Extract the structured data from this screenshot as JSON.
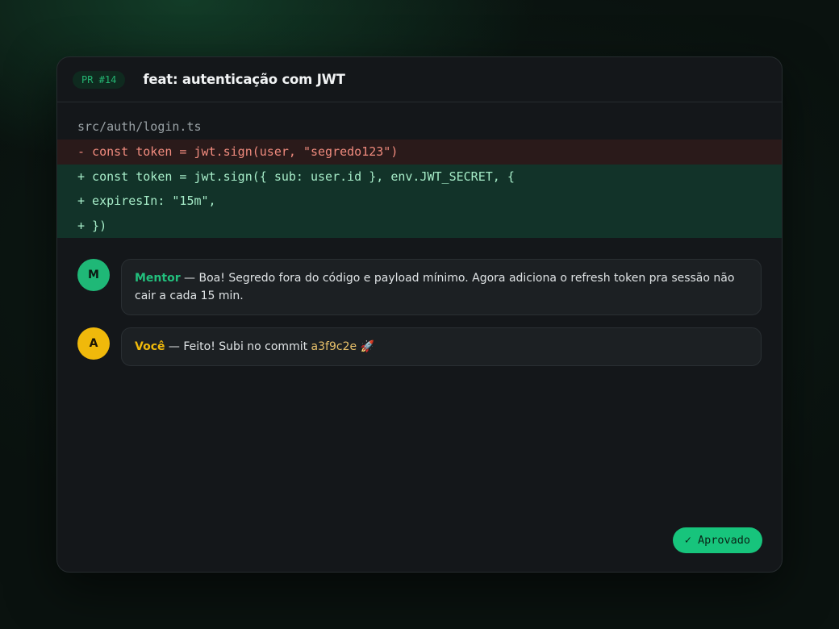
{
  "header": {
    "pr_badge": "PR #14",
    "title": "feat: autenticação com JWT"
  },
  "diff": {
    "file_path": "src/auth/login.ts",
    "lines": [
      {
        "type": "del",
        "text": "- const token = jwt.sign(user, \"segredo123\")"
      },
      {
        "type": "add",
        "text": "+ const token = jwt.sign({ sub: user.id }, env.JWT_SECRET, {"
      },
      {
        "type": "add",
        "text": "+ expiresIn: \"15m\","
      },
      {
        "type": "add",
        "text": "+ })"
      }
    ]
  },
  "comments": [
    {
      "avatar": "M",
      "author": "Mentor",
      "separator": " — ",
      "text": "Boa! Segredo fora do código e payload mínimo. Agora adiciona o refresh token pra sessão não cair a cada 15 min."
    },
    {
      "avatar": "A",
      "author": "Você",
      "separator": " — ",
      "text": "Feito! Subi no commit ",
      "commit": "a3f9c2e",
      "emoji": " 🚀"
    }
  ],
  "status": {
    "label": "✓ Aprovado"
  },
  "colors": {
    "accent": "#17c47c",
    "you": "#f0b90b",
    "del_bg": "#2a1a1a",
    "add_bg": "#123329"
  }
}
